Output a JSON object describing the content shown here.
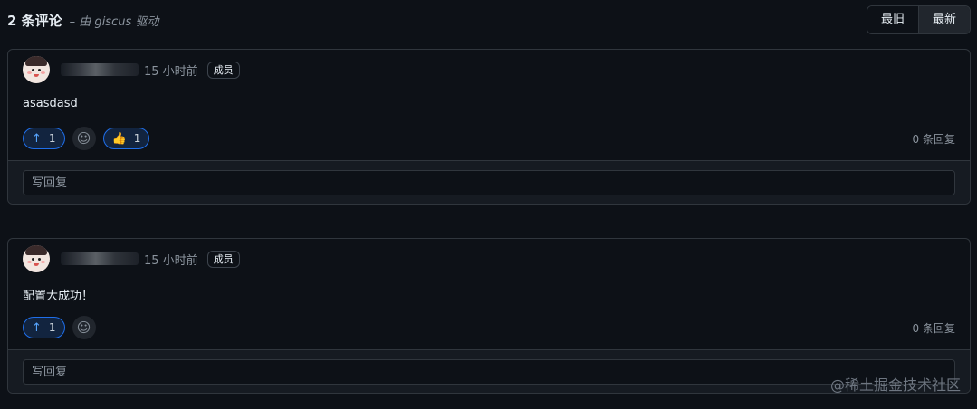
{
  "header": {
    "count": "2 条评论",
    "powered_by": "– 由 giscus 驱动",
    "sort_oldest": "最旧",
    "sort_newest": "最新"
  },
  "comments": [
    {
      "time": "15 小时前",
      "badge": "成员",
      "body": "asasdasd",
      "reactions": [
        {
          "icon": "arrow-up-icon",
          "glyph": "↑",
          "count": "1"
        },
        {
          "icon": "thumbs-up-icon",
          "glyph": "👍",
          "count": "1"
        }
      ],
      "replies": "0 条回复",
      "reply_placeholder": "写回复"
    },
    {
      "time": "15 小时前",
      "badge": "成员",
      "body": "配置大成功！",
      "reactions": [
        {
          "icon": "arrow-up-icon",
          "glyph": "↑",
          "count": "1"
        }
      ],
      "replies": "0 条回复",
      "reply_placeholder": "写回复"
    }
  ],
  "watermark": "@稀土掘金技术社区",
  "colors": {
    "background": "#0d1117",
    "border": "#30363d",
    "accent": "#1f6feb"
  }
}
